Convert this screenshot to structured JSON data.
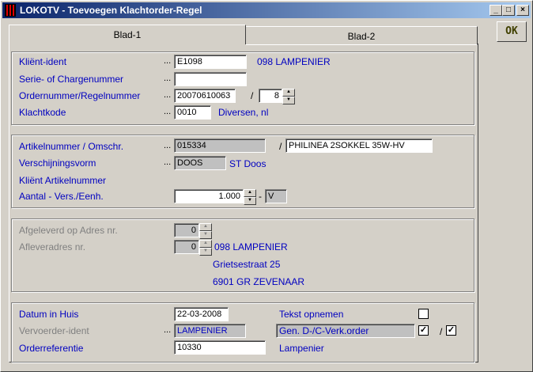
{
  "window": {
    "title": "LOKOTV - Toevoegen Klachtorder-Regel"
  },
  "titlebar_buttons": {
    "minimize": "_",
    "maximize": "□",
    "close": "×"
  },
  "ok_label": "OK",
  "tabs": [
    {
      "label": "Blad-1"
    },
    {
      "label": "Blad-2"
    }
  ],
  "group1": {
    "klient_ident_label": "Kliënt-ident",
    "klient_ident_value": "E1098",
    "klient_name": "098 LAMPENIER",
    "serie_label": "Serie- of Chargenummer",
    "serie_value": "",
    "order_label": "Ordernummer/Regelnummer",
    "order_value": "20070610063",
    "separator": "/",
    "regel_value": "8",
    "klachtkode_label": "Klachtkode",
    "klachtkode_value": "0010",
    "klachtkode_desc": "Diversen, nl"
  },
  "group2": {
    "artikel_label": "Artikelnummer / Omschr.",
    "artikel_value": "015334",
    "separator": "/",
    "omschr_value": "PHILINEA 2SOKKEL 35W-HV",
    "verschijning_label": "Verschijningsvorm",
    "verschijning_value": "DOOS",
    "verschijning_desc": "ST  Doos",
    "klient_artikel_label": "Kliënt Artikelnummer",
    "aantal_label": "Aantal - Vers./Eenh.",
    "aantal_value": "1.000",
    "dash": "-",
    "eenheid_value": "V"
  },
  "group3": {
    "afgeleverd_label": "Afgeleverd op Adres nr.",
    "afgeleverd_value": "0",
    "afleveradres_label": "Afleveradres nr.",
    "afleveradres_value": "0",
    "adres_name": "098 LAMPENIER",
    "adres_street": "Grietsestraat 25",
    "adres_city": "6901  GR  ZEVENAAR"
  },
  "group4": {
    "datum_label": "Datum in Huis",
    "datum_value": "22-03-2008",
    "tekst_label": "Tekst opnemen",
    "tekst_checked": false,
    "vervoerder_label": "Vervoerder-ident",
    "vervoerder_value": "LAMPENIER",
    "gen_label": "Gen. D-/C-Verk.order",
    "gen_checked": true,
    "separator": "/",
    "gen2_checked": true,
    "orderref_label": "Orderreferentie",
    "orderref_value": "10330",
    "orderref_name": "Lampenier"
  },
  "dots": "..."
}
